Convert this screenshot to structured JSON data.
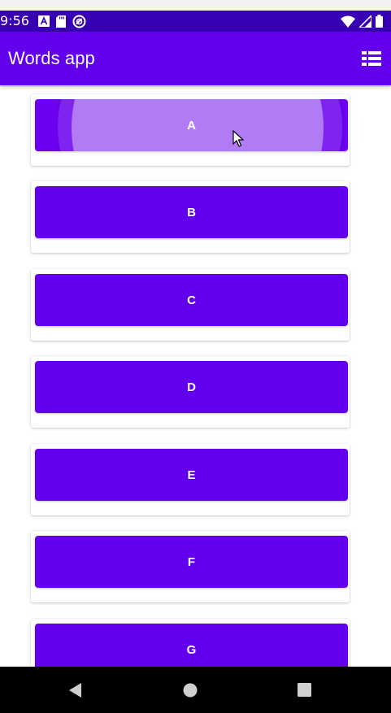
{
  "status_bar": {
    "time": "9:56",
    "left_icons": [
      "font-a-icon",
      "sd-card-icon",
      "sync-icon"
    ],
    "right_icons": [
      "wifi-icon",
      "cellular-signal-icon",
      "battery-icon"
    ]
  },
  "app_bar": {
    "title": "Words app",
    "layout_toggle_icon": "list-layout-icon"
  },
  "letters": [
    {
      "label": "A",
      "pressed": true
    },
    {
      "label": "B",
      "pressed": false
    },
    {
      "label": "C",
      "pressed": false
    },
    {
      "label": "D",
      "pressed": false
    },
    {
      "label": "E",
      "pressed": false
    },
    {
      "label": "F",
      "pressed": false
    },
    {
      "label": "G",
      "pressed": false
    }
  ],
  "navigation": {
    "icons": [
      "back-icon",
      "home-icon",
      "recents-icon"
    ]
  },
  "colors": {
    "primary": "#6200ee",
    "primary_dark": "#3700b3",
    "on_primary": "#ffffff",
    "nav_bar": "#000000"
  }
}
